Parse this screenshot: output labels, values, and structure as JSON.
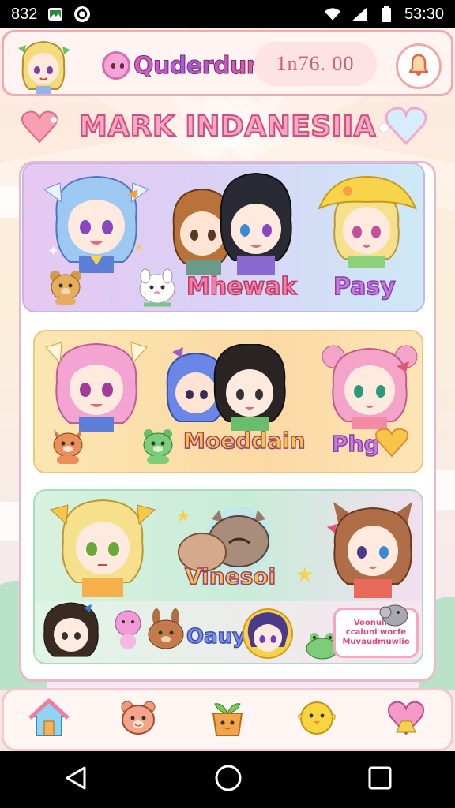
{
  "status_bar": {
    "left_text": "832",
    "time": "53:30"
  },
  "header": {
    "logo_text": "Quderdun",
    "search_text": "1n76. 00"
  },
  "title": "MARK INDANESIIA",
  "cards": [
    {
      "label_main": "Mhewak",
      "label_side": "Pasy"
    },
    {
      "label_main": "Moeddain",
      "label_side": "Phg"
    },
    {
      "label_main": "Vinesoi",
      "label_side": "Oauy",
      "badge": "Voonuin n ccaiuni wocfe Muvaudmuwlie"
    }
  ],
  "icons": {
    "status_left": [
      "sim-icon",
      "gallery-icon",
      "sync-icon"
    ],
    "status_right": [
      "wifi-icon",
      "signal-icon",
      "battery-icon"
    ],
    "bottom_nav": [
      "home-icon",
      "bear-icon",
      "plant-pot-icon",
      "chick-icon",
      "heart-icon"
    ],
    "system_nav": [
      "back-icon",
      "home-circle-icon",
      "recents-icon"
    ]
  },
  "colors": {
    "header_border": "#f2aab1",
    "title_fill": "#f5a9c5",
    "title_stroke": "#d34c7e",
    "card_1": "#dccff5",
    "card_2": "#fbd9a4",
    "card_3": "#c8ecd8"
  }
}
